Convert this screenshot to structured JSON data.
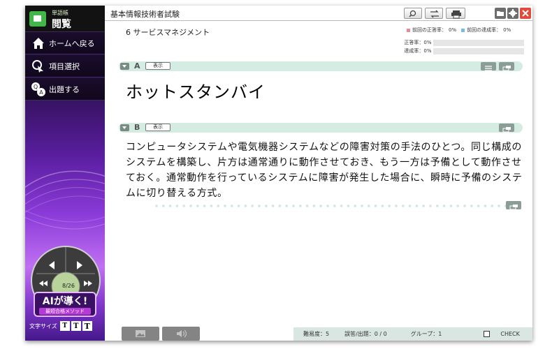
{
  "app": {
    "logo_small": "単語帳",
    "logo_big": "閲覧",
    "title": "基本情報技術者試験"
  },
  "sidebar": {
    "items": [
      {
        "label": "ホームへ戻る",
        "icon": "home-icon"
      },
      {
        "label": "項目選択",
        "icon": "pointer-select-icon"
      },
      {
        "label": "出題する",
        "icon": "quiz-icon"
      }
    ],
    "counter": "8/26",
    "ai_title": "AIが導く!",
    "ai_sub": "最短合格メソッド",
    "font_size_label": "文字サイズ",
    "font_buttons": [
      "T",
      "T",
      "T"
    ]
  },
  "main": {
    "category": "6 サービスマネジメント",
    "stats": {
      "legend_prev_correct": "前回の正答率：",
      "legend_prev_correct_value": "0%",
      "legend_prev_achieve": "前回の達成率：",
      "legend_prev_achieve_value": "0%",
      "correct_label": "正答率：",
      "correct_value": "0%",
      "achieve_label": "達成率：",
      "achieve_value": "0%",
      "correct_rate": 0,
      "achieve_rate": 0,
      "colors": {
        "prev_correct": "#e88a9a",
        "prev_achieve": "#7ab8e8"
      }
    },
    "section_a": {
      "letter": "A",
      "show": "表示"
    },
    "section_b": {
      "letter": "B",
      "show": "表示"
    },
    "term": "ホットスタンバイ",
    "description": "コンピュータシステムや電気機器システムなどの障害対策の手法のひとつ。同じ構成のシステムを構築し、片方は通常通りに動作させておき、もう一方は予備として動作させておく。通常動作を行っているシステムに障害が発生した場合に、瞬時に予備のシステムに切り替える方式。"
  },
  "footer": {
    "difficulty": "難易度：5",
    "mistakes": "誤答/出題：0 / 0",
    "group": "グループ：1",
    "check": "CHECK"
  }
}
